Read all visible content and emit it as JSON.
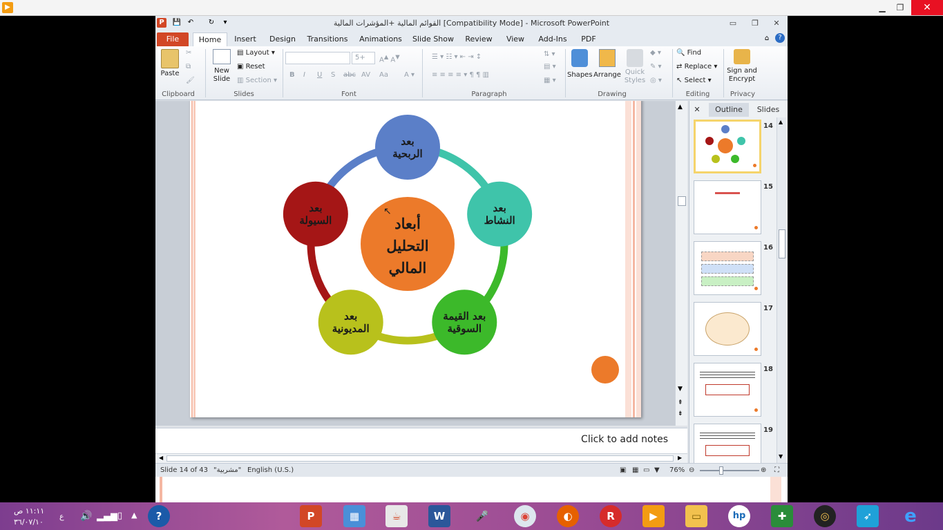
{
  "window": {
    "title": "القوائم المالية +المؤشرات المالية [Compatibility Mode] - Microsoft PowerPoint"
  },
  "tabs": [
    {
      "label": "File"
    },
    {
      "label": "Home"
    },
    {
      "label": "Insert"
    },
    {
      "label": "Design"
    },
    {
      "label": "Transitions"
    },
    {
      "label": "Animations"
    },
    {
      "label": "Slide Show"
    },
    {
      "label": "Review"
    },
    {
      "label": "View"
    },
    {
      "label": "Add-Ins"
    },
    {
      "label": "PDF"
    }
  ],
  "ribbon": {
    "clipboard": {
      "label": "Clipboard",
      "paste": "Paste"
    },
    "slides": {
      "label": "Slides",
      "new_slide": "New Slide",
      "layout": "Layout",
      "reset": "Reset",
      "section": "Section"
    },
    "font": {
      "label": "Font",
      "size": "5+"
    },
    "paragraph": {
      "label": "Paragraph"
    },
    "drawing": {
      "label": "Drawing",
      "shapes": "Shapes",
      "arrange": "Arrange",
      "quick_styles": "Quick Styles"
    },
    "editing": {
      "label": "Editing",
      "find": "Find",
      "replace": "Replace",
      "select": "Select"
    },
    "privacy": {
      "label": "Privacy",
      "sign_encrypt": "Sign and Encrypt"
    }
  },
  "slide": {
    "center": "أبعاد التحليل المالي",
    "nodes": [
      {
        "text": "بعد الربحية",
        "color": "#5b7fc8"
      },
      {
        "text": "بعد النشاط",
        "color": "#3fc4aa"
      },
      {
        "text": "بعد القيمة السوقية",
        "color": "#3cb92a"
      },
      {
        "text": "بعد المديونية",
        "color": "#b8c11c"
      },
      {
        "text": "بعد السيولة",
        "color": "#a51616"
      }
    ],
    "center_color": "#ec7a2a"
  },
  "side_panel": {
    "outline_tab": "Outline",
    "slides_tab": "Slides",
    "thumbnails": [
      {
        "number": "14"
      },
      {
        "number": "15"
      },
      {
        "number": "16"
      },
      {
        "number": "17"
      },
      {
        "number": "18"
      },
      {
        "number": "19"
      }
    ]
  },
  "notes": {
    "placeholder": "Click to add notes"
  },
  "status": {
    "slide_info": "Slide 14 of 43",
    "theme": "\"مشربية\"",
    "language": "English (U.S.)",
    "zoom": "76%"
  },
  "taskbar": {
    "time": "١١:١١ ص",
    "date": "٣٦/٠٧/١٠",
    "lang": "ع"
  }
}
